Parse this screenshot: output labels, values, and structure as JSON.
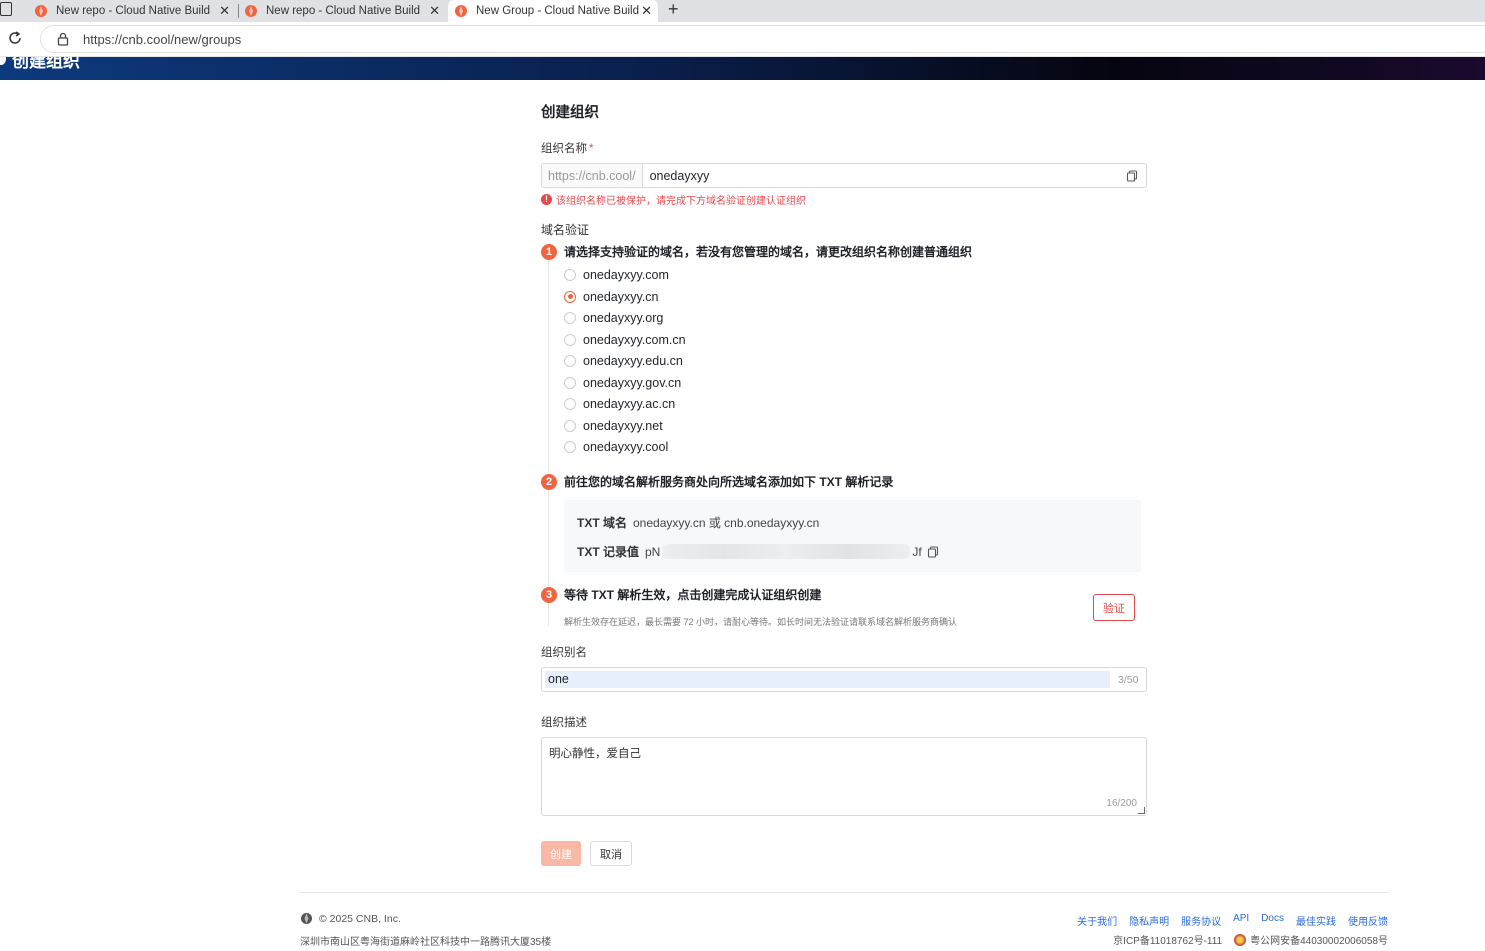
{
  "browser": {
    "tabs": [
      {
        "title": "New repo - Cloud Native Build",
        "active": false
      },
      {
        "title": "New repo - Cloud Native Build",
        "active": false
      },
      {
        "title": "New Group - Cloud Native Build",
        "active": true
      }
    ],
    "new_tab_label": "+",
    "close_glyph": "✕",
    "url": "https://cnb.cool/new/groups"
  },
  "banner": {
    "title": "创建组织"
  },
  "form": {
    "title": "创建组织",
    "name_label": "组织名称",
    "required_mark": "*",
    "url_prefix": "https://cnb.cool/",
    "name_value": "onedayxyy",
    "error_icon": "!",
    "error_text": "该组织名称已被保护，请完成下方域名验证创建认证组织",
    "domain_verify_label": "域名验证",
    "step1": {
      "num": "1",
      "text": "请选择支持验证的域名，若没有您管理的域名，请更改组织名称创建普通组织"
    },
    "domains": [
      {
        "label": "onedayxyy.com",
        "checked": false
      },
      {
        "label": "onedayxyy.cn",
        "checked": true
      },
      {
        "label": "onedayxyy.org",
        "checked": false
      },
      {
        "label": "onedayxyy.com.cn",
        "checked": false
      },
      {
        "label": "onedayxyy.edu.cn",
        "checked": false
      },
      {
        "label": "onedayxyy.gov.cn",
        "checked": false
      },
      {
        "label": "onedayxyy.ac.cn",
        "checked": false
      },
      {
        "label": "onedayxyy.net",
        "checked": false
      },
      {
        "label": "onedayxyy.cool",
        "checked": false
      }
    ],
    "step2": {
      "num": "2",
      "text": "前往您的域名解析服务商处向所选域名添加如下 TXT 解析记录"
    },
    "txt_domain_key": "TXT 域名",
    "txt_domain_value": "onedayxyy.cn 或 cnb.onedayxyy.cn",
    "txt_record_key": "TXT 记录值",
    "txt_record_prefix": "pN",
    "txt_record_suffix": "Jf",
    "step3": {
      "num": "3",
      "text": "等待 TXT 解析生效，点击创建完成认证组织创建"
    },
    "step3_hint": "解析生效存在延迟，最长需要 72 小时，请耐心等待。如长时间无法验证请联系域名解析服务商确认",
    "verify_button": "验证",
    "alias_label": "组织别名",
    "alias_value": "one",
    "alias_counter": "3/50",
    "desc_label": "组织描述",
    "desc_value": "明心静性，爱自己",
    "desc_counter": "16/200",
    "create_button": "创建",
    "cancel_button": "取消"
  },
  "footer": {
    "copyright": "© 2025 CNB, Inc.",
    "address": "深圳市南山区粤海街道麻岭社区科技中一路腾讯大厦35楼",
    "links": [
      "关于我们",
      "隐私声明",
      "服务协议",
      "API",
      "Docs",
      "最佳实践",
      "使用反馈"
    ],
    "icp": "京ICP备11018762号-111",
    "police": "粤公网安备44030002006058号"
  },
  "colors": {
    "accent": "#f0653f",
    "error": "#e5484d",
    "link": "#2a6bd6"
  },
  "icons": [
    "cnb-logo-icon",
    "reload-icon",
    "lock-icon",
    "copy-icon",
    "error-icon",
    "police-badge-icon"
  ]
}
